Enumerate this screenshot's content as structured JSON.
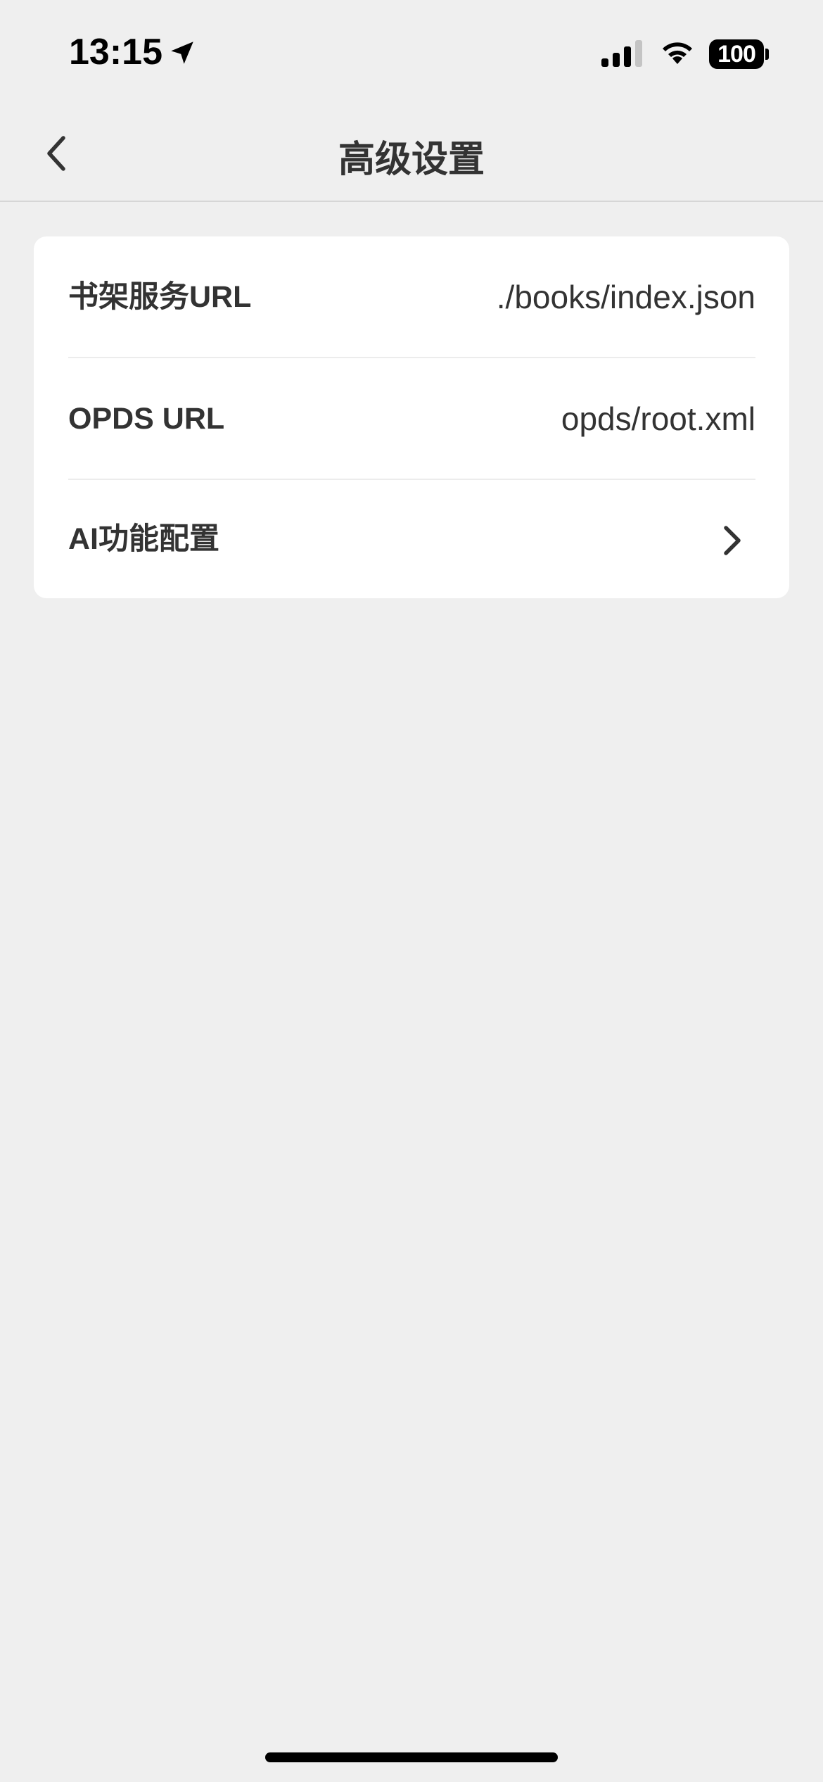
{
  "status_bar": {
    "time": "13:15",
    "battery": "100",
    "icons": [
      "location-arrow-icon",
      "cellular-signal-icon",
      "wifi-icon",
      "battery-icon"
    ]
  },
  "nav": {
    "title": "高级设置",
    "back_icon": "chevron-left-icon"
  },
  "settings": {
    "rows": [
      {
        "label": "书架服务URL",
        "value": "./books/index.json"
      },
      {
        "label": "OPDS URL",
        "value": "opds/root.xml"
      },
      {
        "label": "AI功能配置",
        "icon": "chevron-right-icon"
      }
    ]
  },
  "colors": {
    "background": "#efefef",
    "card": "#ffffff",
    "text": "#333333"
  }
}
